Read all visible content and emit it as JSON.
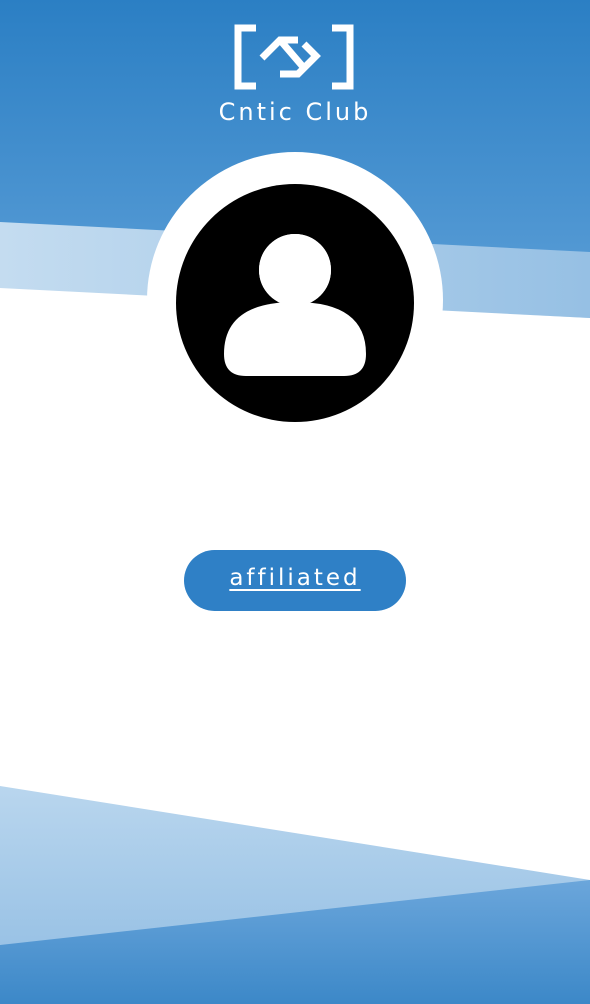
{
  "brand": {
    "name": "Cntic Club",
    "logo": "cntic-club-logo"
  },
  "profile": {
    "avatar": "user-avatar-placeholder-icon",
    "status_label": "affiliated"
  },
  "colors": {
    "primary_blue": "#2f80c6",
    "light_blue": "#9cc4e6",
    "white": "#ffffff",
    "avatar": "#000000"
  }
}
